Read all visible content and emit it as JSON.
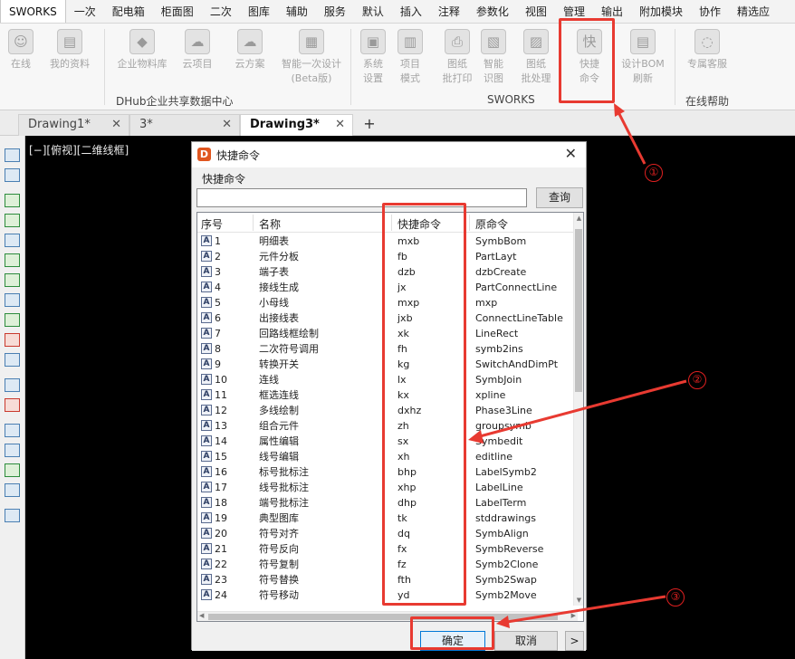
{
  "menubar": {
    "items": [
      "SWORKS",
      "一次",
      "配电箱",
      "柜面图",
      "二次",
      "图库",
      "辅助",
      "服务",
      "默认",
      "插入",
      "注释",
      "参数化",
      "视图",
      "管理",
      "输出",
      "附加模块",
      "协作",
      "精选应"
    ]
  },
  "ribbon": {
    "buttons": [
      {
        "label": "在线",
        "icon": "online-user-icon",
        "glyph": "☺"
      },
      {
        "label": "我的资料",
        "icon": "my-docs-icon",
        "glyph": "▤"
      },
      {
        "label": "企业物料库",
        "icon": "material-library-icon",
        "glyph": "◆"
      },
      {
        "label": "云项目",
        "icon": "cloud-project-icon",
        "glyph": "☁"
      },
      {
        "label": "云方案",
        "icon": "cloud-scheme-icon",
        "glyph": "☁"
      },
      {
        "label": "智能一次设计\n(Beta版)",
        "icon": "smart-design-icon",
        "glyph": "▦"
      },
      {
        "label": "系统\n设置",
        "icon": "system-settings-icon",
        "glyph": "▣"
      },
      {
        "label": "项目\n模式",
        "icon": "project-mode-icon",
        "glyph": "▥"
      },
      {
        "label": "图纸\n批打印",
        "icon": "batch-print-icon",
        "glyph": "⎙"
      },
      {
        "label": "智能\n识图",
        "icon": "smart-recognize-icon",
        "glyph": "▧"
      },
      {
        "label": "图纸\n批处理",
        "icon": "batch-process-icon",
        "glyph": "▨"
      },
      {
        "label": "快捷\n命令",
        "icon": "shortcut-command-icon",
        "glyph": "快"
      },
      {
        "label": "设计BOM\n刷新",
        "icon": "bom-refresh-icon",
        "glyph": "▤"
      },
      {
        "label": "专属客服",
        "icon": "customer-service-icon",
        "glyph": "◌"
      }
    ],
    "groups": [
      "DHub企业共享数据中心",
      "SWORKS",
      "在线帮助"
    ]
  },
  "tabs": [
    {
      "label": "Drawing1*"
    },
    {
      "label": "3*"
    },
    {
      "label": "Drawing3*"
    }
  ],
  "canvas": {
    "view_label": "[−][俯视][二维线框]"
  },
  "dialog": {
    "title": "快捷命令",
    "group_label": "快捷命令",
    "search": {
      "value": "",
      "button": "查询"
    },
    "columns": [
      "序号",
      "名称",
      "快捷命令",
      "原命令"
    ],
    "rows": [
      {
        "no": "1",
        "name": "明细表",
        "short": "mxb",
        "orig": "SymbBom"
      },
      {
        "no": "2",
        "name": "元件分板",
        "short": "fb",
        "orig": "PartLayt"
      },
      {
        "no": "3",
        "name": "端子表",
        "short": "dzb",
        "orig": "dzbCreate"
      },
      {
        "no": "4",
        "name": "接线生成",
        "short": "jx",
        "orig": "PartConnectLine"
      },
      {
        "no": "5",
        "name": "小母线",
        "short": "mxp",
        "orig": "mxp"
      },
      {
        "no": "6",
        "name": "出接线表",
        "short": "jxb",
        "orig": "ConnectLineTable"
      },
      {
        "no": "7",
        "name": "回路线框绘制",
        "short": "xk",
        "orig": "LineRect"
      },
      {
        "no": "8",
        "name": "二次符号调用",
        "short": "fh",
        "orig": "symb2ins"
      },
      {
        "no": "9",
        "name": "转换开关",
        "short": "kg",
        "orig": "SwitchAndDimPt"
      },
      {
        "no": "10",
        "name": "连线",
        "short": "lx",
        "orig": "SymbJoin"
      },
      {
        "no": "11",
        "name": "框选连线",
        "short": "kx",
        "orig": "xpline"
      },
      {
        "no": "12",
        "name": "多线绘制",
        "short": "dxhz",
        "orig": "Phase3Line"
      },
      {
        "no": "13",
        "name": "组合元件",
        "short": "zh",
        "orig": "groupsymb"
      },
      {
        "no": "14",
        "name": "属性编辑",
        "short": "sx",
        "orig": "Symbedit"
      },
      {
        "no": "15",
        "name": "线号编辑",
        "short": "xh",
        "orig": "editline"
      },
      {
        "no": "16",
        "name": "标号批标注",
        "short": "bhp",
        "orig": "LabelSymb2"
      },
      {
        "no": "17",
        "name": "线号批标注",
        "short": "xhp",
        "orig": "LabelLine"
      },
      {
        "no": "18",
        "name": "端号批标注",
        "short": "dhp",
        "orig": "LabelTerm"
      },
      {
        "no": "19",
        "name": "典型图库",
        "short": "tk",
        "orig": "stddrawings"
      },
      {
        "no": "20",
        "name": "符号对齐",
        "short": "dq",
        "orig": "SymbAlign"
      },
      {
        "no": "21",
        "name": "符号反向",
        "short": "fx",
        "orig": "SymbReverse"
      },
      {
        "no": "22",
        "name": "符号复制",
        "short": "fz",
        "orig": "Symb2Clone"
      },
      {
        "no": "23",
        "name": "符号替换",
        "short": "fth",
        "orig": "Symb2Swap"
      },
      {
        "no": "24",
        "name": "符号移动",
        "short": "yd",
        "orig": "Symb2Move"
      }
    ],
    "buttons": {
      "ok": "确定",
      "cancel": "取消",
      "more": ">"
    }
  },
  "annotations": {
    "callout_1": "①",
    "callout_2": "②",
    "callout_3": "③",
    "color": "#e83a31"
  }
}
